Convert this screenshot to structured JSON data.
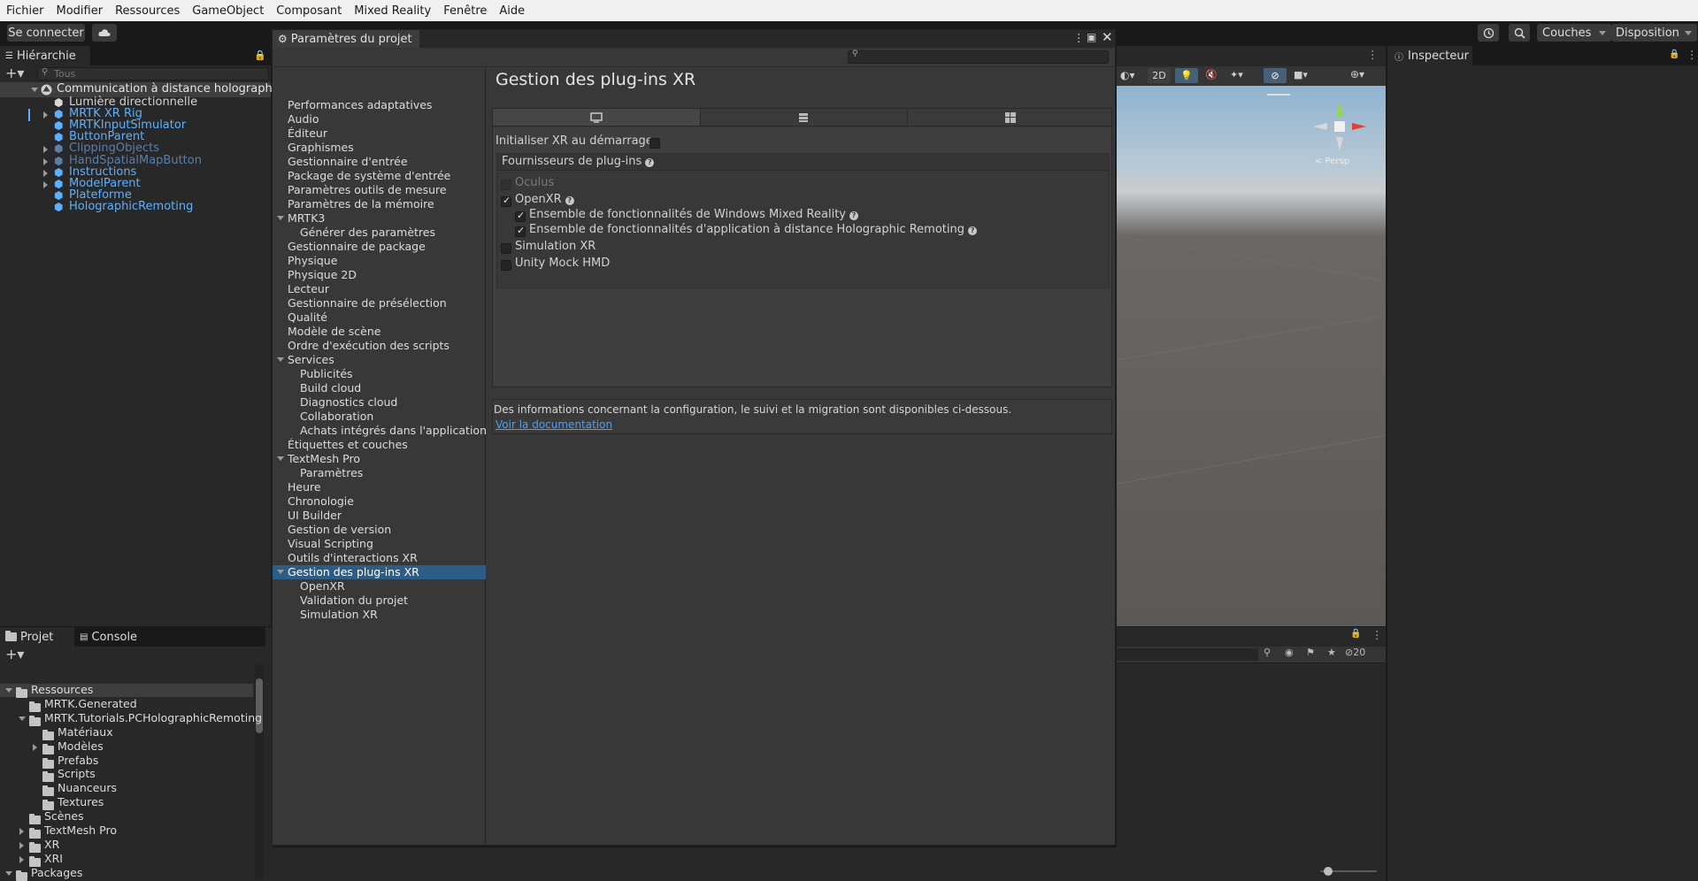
{
  "menubar": [
    "Fichier",
    "Modifier",
    "Ressources",
    "GameObject",
    "Composant",
    "Mixed Reality",
    "Fenêtre",
    "Aide"
  ],
  "toolbar": {
    "connect": "Se connecter",
    "layers": "Couches",
    "layout": "Disposition"
  },
  "hierarchy": {
    "tab": "Hiérarchie",
    "search_placeholder": "Tous",
    "root": "Communication à distance holographique",
    "items": [
      {
        "label": "Lumière directionnelle",
        "style": "normal",
        "arrow": false
      },
      {
        "label": "MRTK XR Rig",
        "style": "blue",
        "arrow": true
      },
      {
        "label": "MRTKInputSimulator",
        "style": "blue",
        "arrow": false
      },
      {
        "label": "ButtonParent",
        "style": "blue",
        "arrow": false
      },
      {
        "label": "ClippingObjects",
        "style": "dim",
        "arrow": true
      },
      {
        "label": "HandSpatialMapButton",
        "style": "dim",
        "arrow": true
      },
      {
        "label": "Instructions",
        "style": "blue",
        "arrow": true
      },
      {
        "label": "ModelParent",
        "style": "blue",
        "arrow": true
      },
      {
        "label": "Plateforme",
        "style": "blue",
        "arrow": false
      },
      {
        "label": "HolographicRemoting",
        "style": "blue",
        "arrow": false
      }
    ]
  },
  "project": {
    "tab_project": "Projet",
    "tab_console": "Console",
    "tree": [
      {
        "label": "Ressources",
        "level": 0,
        "arrow": "down",
        "selected": true
      },
      {
        "label": "MRTK.Generated",
        "level": 1,
        "arrow": "none"
      },
      {
        "label": "MRTK.Tutorials.PCHolographicRemoting",
        "level": 1,
        "arrow": "down"
      },
      {
        "label": "Matériaux",
        "level": 2,
        "arrow": "none"
      },
      {
        "label": "Modèles",
        "level": 2,
        "arrow": "right"
      },
      {
        "label": "Prefabs",
        "level": 2,
        "arrow": "none"
      },
      {
        "label": "Scripts",
        "level": 2,
        "arrow": "none"
      },
      {
        "label": "Nuanceurs",
        "level": 2,
        "arrow": "none"
      },
      {
        "label": "Textures",
        "level": 2,
        "arrow": "none"
      },
      {
        "label": "Scènes",
        "level": 1,
        "arrow": "none"
      },
      {
        "label": "TextMesh Pro",
        "level": 1,
        "arrow": "right"
      },
      {
        "label": "XR",
        "level": 1,
        "arrow": "right"
      },
      {
        "label": "XRI",
        "level": 1,
        "arrow": "right"
      },
      {
        "label": "Packages",
        "level": 0,
        "arrow": "down"
      }
    ]
  },
  "settings": {
    "title": "Paramètres du projet",
    "nav": [
      {
        "label": "Performances adaptatives",
        "indent": 0
      },
      {
        "label": "Audio",
        "indent": 0
      },
      {
        "label": "Éditeur",
        "indent": 0
      },
      {
        "label": "Graphismes",
        "indent": 0
      },
      {
        "label": "Gestionnaire d'entrée",
        "indent": 0
      },
      {
        "label": "Package de système d'entrée",
        "indent": 0
      },
      {
        "label": "Paramètres outils de mesure",
        "indent": 0
      },
      {
        "label": "Paramètres de la mémoire",
        "indent": 0
      },
      {
        "label": "MRTK3",
        "indent": 0,
        "expand": true
      },
      {
        "label": "Générer des paramètres",
        "indent": 1
      },
      {
        "label": "Gestionnaire de package",
        "indent": 0
      },
      {
        "label": "Physique",
        "indent": 0
      },
      {
        "label": "Physique 2D",
        "indent": 0
      },
      {
        "label": "Lecteur",
        "indent": 0
      },
      {
        "label": "Gestionnaire de présélection",
        "indent": 0
      },
      {
        "label": "Qualité",
        "indent": 0
      },
      {
        "label": "Modèle de scène",
        "indent": 0
      },
      {
        "label": "Ordre d'exécution des scripts",
        "indent": 0
      },
      {
        "label": "Services",
        "indent": 0,
        "expand": true
      },
      {
        "label": "Publicités",
        "indent": 1
      },
      {
        "label": "Build cloud",
        "indent": 1
      },
      {
        "label": "Diagnostics cloud",
        "indent": 1
      },
      {
        "label": "Collaboration",
        "indent": 1
      },
      {
        "label": "Achats intégrés dans l'application",
        "indent": 1
      },
      {
        "label": "Étiquettes et couches",
        "indent": 0
      },
      {
        "label": "TextMesh Pro",
        "indent": 0,
        "expand": true
      },
      {
        "label": "Paramètres",
        "indent": 1
      },
      {
        "label": "Heure",
        "indent": 0
      },
      {
        "label": "Chronologie",
        "indent": 0
      },
      {
        "label": "UI Builder",
        "indent": 0
      },
      {
        "label": "Gestion de version",
        "indent": 0
      },
      {
        "label": "Visual Scripting",
        "indent": 0
      },
      {
        "label": "Outils d'interactions XR",
        "indent": 0
      },
      {
        "label": "Gestion des plug-ins XR",
        "indent": 0,
        "expand": true,
        "selected": true
      },
      {
        "label": "OpenXR",
        "indent": 1
      },
      {
        "label": "Validation du projet",
        "indent": 1
      },
      {
        "label": "Simulation XR",
        "indent": 1
      }
    ],
    "heading": "Gestion des plug-ins XR",
    "init_label": "Initialiser XR au démarrage",
    "providers_header": "Fournisseurs de plug-ins",
    "providers": [
      {
        "label": "Oculus",
        "checked": false,
        "disabled": true,
        "indent": 0,
        "help": false
      },
      {
        "label": "OpenXR",
        "checked": true,
        "disabled": false,
        "indent": 0,
        "help": true
      },
      {
        "label": "Ensemble de fonctionnalités de Windows Mixed Reality",
        "checked": true,
        "disabled": false,
        "indent": 1,
        "help": true
      },
      {
        "label": "Ensemble de fonctionnalités d'application à distance Holographic Remoting",
        "checked": true,
        "disabled": false,
        "indent": 1,
        "help": true
      },
      {
        "label": "Simulation XR",
        "checked": false,
        "disabled": false,
        "indent": 0,
        "help": false
      },
      {
        "label": "Unity Mock HMD",
        "checked": false,
        "disabled": false,
        "indent": 0,
        "help": false
      }
    ],
    "info_text": "Des informations concernant la configuration, le suivi et la migration sont disponibles ci-dessous.",
    "doc_link": "Voir la documentation"
  },
  "scene": {
    "mode_2d": "2D",
    "persp": "< Persp",
    "hidden_count": "20"
  },
  "inspector": {
    "tab": "Inspecteur"
  },
  "colors": {
    "selection": "#2c5d87",
    "link": "#4c9fff",
    "blue_obj": "#5cb0ff"
  }
}
